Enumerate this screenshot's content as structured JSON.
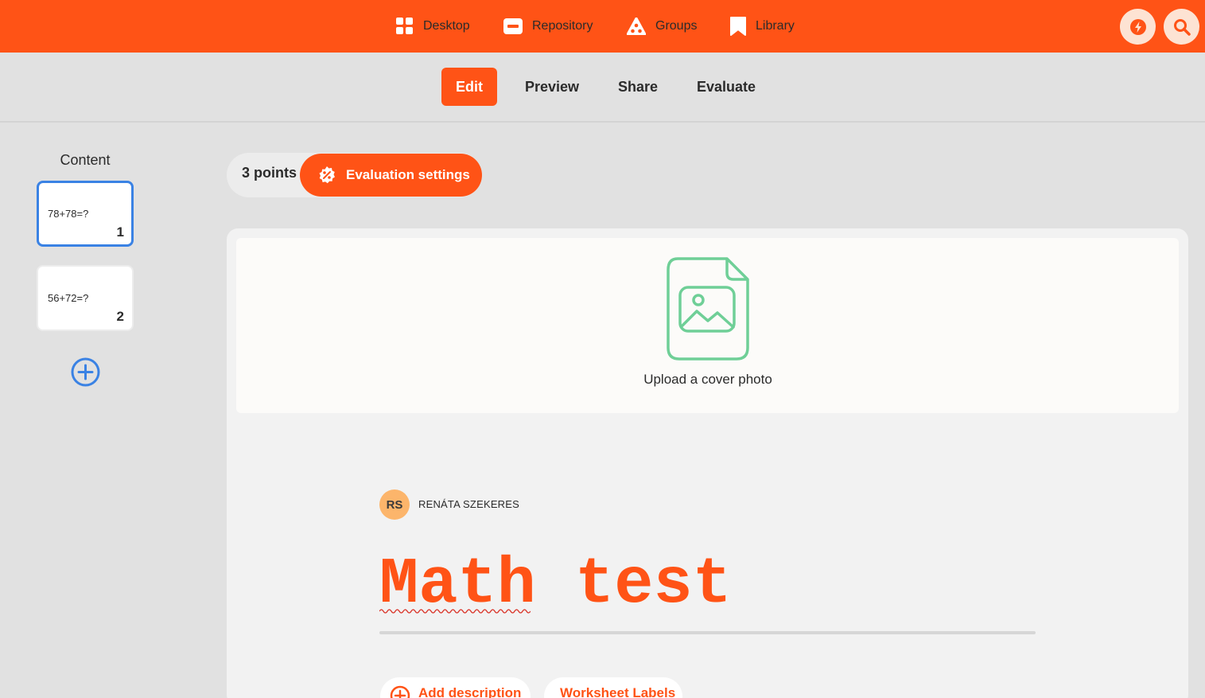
{
  "topnav": {
    "items": [
      {
        "label": "Desktop",
        "icon": "grid-icon"
      },
      {
        "label": "Repository",
        "icon": "repository-icon"
      },
      {
        "label": "Groups",
        "icon": "groups-icon"
      },
      {
        "label": "Library",
        "icon": "bookmark-icon"
      }
    ],
    "actions": [
      {
        "icon": "bolt-icon"
      },
      {
        "icon": "search-icon"
      }
    ]
  },
  "tabs": [
    {
      "label": "Edit",
      "active": true
    },
    {
      "label": "Preview",
      "active": false
    },
    {
      "label": "Share",
      "active": false
    },
    {
      "label": "Evaluate",
      "active": false
    }
  ],
  "sidebar": {
    "title": "Content",
    "cards": [
      {
        "question": "78+78=?",
        "number": "1",
        "selected": true
      },
      {
        "question": "56+72=?",
        "number": "2",
        "selected": false
      }
    ]
  },
  "evaluation": {
    "points": "3 points",
    "settings_label": "Evaluation settings"
  },
  "cover": {
    "label": "Upload a cover photo"
  },
  "author": {
    "initials": "RS",
    "name": "RENÁTA SZEKERES"
  },
  "worksheet": {
    "title": "Math test"
  },
  "chips": {
    "add_description": "Add description",
    "labels": "Worksheet Labels"
  },
  "colors": {
    "accent": "#ff5316",
    "selection": "#3a82e4",
    "cover_icon": "#6fcf97"
  }
}
